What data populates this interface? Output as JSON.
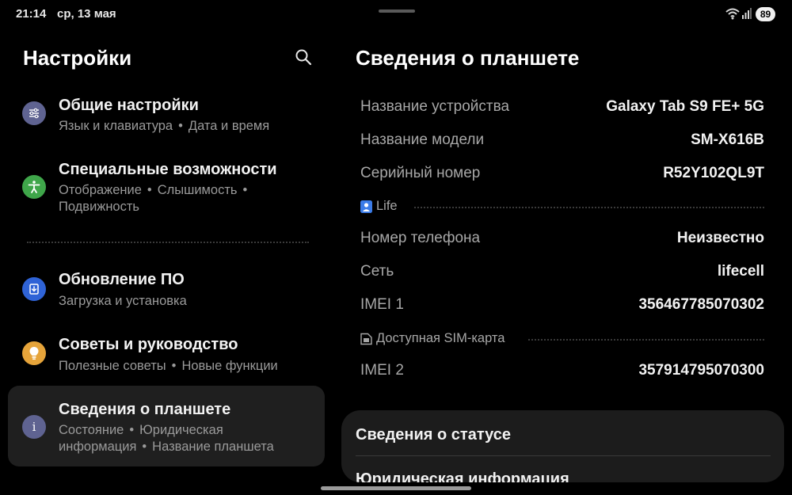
{
  "status_bar": {
    "time": "21:14",
    "date": "ср, 13 мая",
    "battery": "89"
  },
  "left_pane": {
    "title": "Настройки",
    "items": [
      {
        "title": "Общие настройки",
        "subtitle": [
          "Язык и клавиатура",
          "Дата и время"
        ],
        "icon": "sliders-icon",
        "icon_color": "#5f6391"
      },
      {
        "title": "Специальные возможности",
        "subtitle_line1": [
          "Отображение",
          "Слышимость",
          ""
        ],
        "subtitle_line2": "Подвижность",
        "icon": "accessibility-icon",
        "icon_color": "#3fa64a"
      },
      {
        "title": "Обновление ПО",
        "subtitle": [
          "Загрузка и установка"
        ],
        "icon": "software-update-icon",
        "icon_color": "#2f63d6"
      },
      {
        "title": "Советы и руководство",
        "subtitle": [
          "Полезные советы",
          "Новые функции"
        ],
        "icon": "lightbulb-icon",
        "icon_color": "#e6a43a"
      },
      {
        "title": "Сведения о планшете",
        "subtitle_line1": [
          "Состояние",
          "Юридическая"
        ],
        "subtitle_line2": [
          "информация",
          "Название планшета"
        ],
        "icon": "info-icon",
        "icon_color": "#5f6391",
        "selected": true
      }
    ]
  },
  "right_pane": {
    "title": "Сведения о планшете",
    "rows_top": [
      {
        "label": "Название устройства",
        "value": "Galaxy Tab S9 FE+ 5G"
      },
      {
        "label": "Название модели",
        "value": "SM-X616B"
      },
      {
        "label": "Серийный номер",
        "value": "R52Y102QL9T"
      }
    ],
    "sim1": {
      "label": "Life",
      "icon": "sim-person-icon",
      "icon_color": "#3b7ce8",
      "rows": [
        {
          "label": "Номер телефона",
          "value": "Неизвестно"
        },
        {
          "label": "Сеть",
          "value": "lifecell"
        },
        {
          "label": "IMEI 1",
          "value": "356467785070302"
        }
      ]
    },
    "sim2": {
      "label": "Доступная SIM-карта",
      "icon": "sim-card-icon",
      "rows": [
        {
          "label": "IMEI 2",
          "value": "357914795070300"
        }
      ]
    },
    "card": {
      "item1": "Сведения о статусе",
      "item2": "Юридическая информация"
    }
  }
}
